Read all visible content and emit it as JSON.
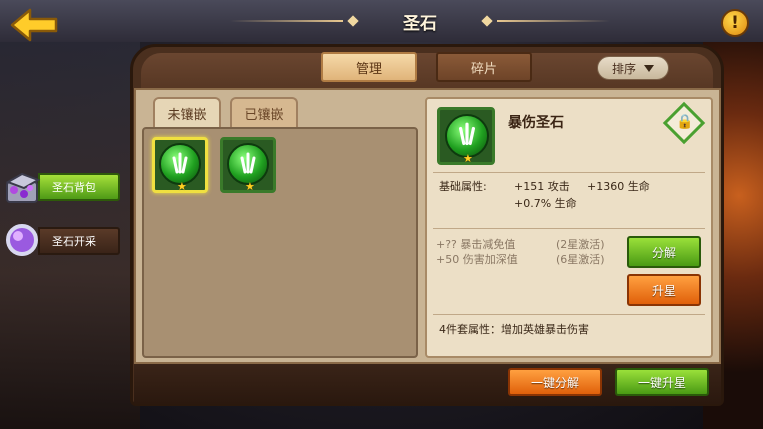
{
  "header": {
    "title": "圣石"
  },
  "tabs": [
    {
      "label": "管理",
      "active": true
    },
    {
      "label": "碎片",
      "active": false
    }
  ],
  "sort": {
    "label": "排序"
  },
  "subtabs": [
    {
      "label": "未镶嵌",
      "active": true
    },
    {
      "label": "已镶嵌",
      "active": false
    }
  ],
  "gems": [
    {
      "stars": 1,
      "selected": true
    },
    {
      "stars": 1,
      "selected": false
    }
  ],
  "side_menu": [
    {
      "label": "圣石背包",
      "icon": "chest-icon",
      "active": true
    },
    {
      "label": "圣石开采",
      "icon": "orb-icon",
      "active": false
    }
  ],
  "detail": {
    "name": "暴伤圣石",
    "base_label": "基础属性:",
    "attrs": [
      "+151 攻击",
      "+1360 生命",
      "+0.7% 生命"
    ],
    "extras": [
      {
        "text": "+?? 暴击减免值",
        "note": "(2星激活)"
      },
      {
        "text": "+50 伤害加深值",
        "note": "(6星激活)"
      }
    ],
    "set_bonus": "4件套属性：增加英雄暴击伤害",
    "btn_decompose": "分解",
    "btn_upstar": "升星"
  },
  "footer": {
    "btn_one_decompose": "一键分解",
    "btn_one_upstar": "一键升星"
  },
  "colors": {
    "accent_green": "#4a9a14",
    "accent_orange": "#e0600a",
    "panel": "#ecdfc6"
  }
}
